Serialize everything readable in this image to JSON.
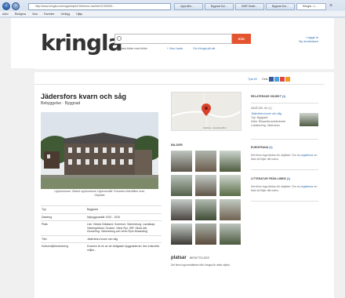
{
  "browser": {
    "address": "http://www.kringla.nu/kringla/objekt?referens=raa/bbr/21300000...",
    "tabs": [
      "Upproller...",
      "Bygnad Kul...",
      "KMR Sweb...",
      "Bygnad Kul...",
      "Kringla - L..."
    ],
    "menu": [
      "Arkiv",
      "Redigera",
      "Visa",
      "Favoriter",
      "Verktyg",
      "Hjälp"
    ]
  },
  "header": {
    "logo": "kringla",
    "search_placeholder": "",
    "search_button": "SÖK",
    "option_checkbox": "Endast bilder med bilder",
    "option_all": "+ Visa i karta",
    "option_link": "Om Kringla på nät",
    "login": "Logga in",
    "register": "Ny användare"
  },
  "share": {
    "label_left": "Tyck till",
    "label_right": "Dela"
  },
  "object": {
    "title": "Jädersfors kvarn och såg",
    "subtitle": "Bebyggelse · Byggnad",
    "caption": "Upphovsman: Okänd upphovsman Upphovsrätt: Fotoarkiv bibehållen kvar; Objektet"
  },
  "facts": [
    {
      "key": "Typ",
      "value": "Byggnad"
    },
    {
      "key": "Datering",
      "value": "Nybyggnadsår 1910 - 1910"
    },
    {
      "key": "Plats",
      "value": "Län: Västra Götaland, Kommun: Vänersborg, Landskap: Västergötland, Socken: Väne-Ryr, SIR: Skola där, Hovsering: Vänersborg och Vene-Ryrs församling"
    },
    {
      "key": "Titel",
      "value": "Jädersfors kvarn och såg"
    },
    {
      "key": "Kulturmiljöbeskrivning",
      "value": "Kvarnen är en av de viktigaste byggnaderna i den kulturella miljön..."
    }
  ],
  "middle": {
    "map_footer": "Kartdata  ·  Användarvillkor",
    "images_heading": "BILDER",
    "platsar_logo": "platsar",
    "platsar_heading": "BERÄTTELSER",
    "platsar_text": "Det finns inga berättelser från Kringla för detta objekt."
  },
  "right": {
    "related_heading": "RELATERADE OBJEKT",
    "related_count": "(1)",
    "related_sub": "INGÅ DEL AV (1)",
    "related_link": "Jädersfors kvarn och såg",
    "related_type": "Typ: Byggnad",
    "related_owner": "Källa: Riksantikvarieämbetet",
    "related_place": "Lokalisering: Jädersfors",
    "europeana_heading": "EUROPEANA",
    "europeana_count": "(1)",
    "europeana_text": "Det finns inga länkar för objektet. Om du",
    "europeana_link": "registrerar",
    "europeana_text2": "en länk så följer ditt namn.",
    "litteratur_heading": "LITTERATUR FRÅN LIBRIS",
    "litteratur_count": "(1)",
    "litteratur_text": "Det finns inga länkar för objektet. Om du",
    "litteratur_link": "registrerar",
    "litteratur_text2": "en länk så följer ditt namn."
  },
  "colors": {
    "accent": "#e4542f",
    "link": "#2f6fb3"
  }
}
